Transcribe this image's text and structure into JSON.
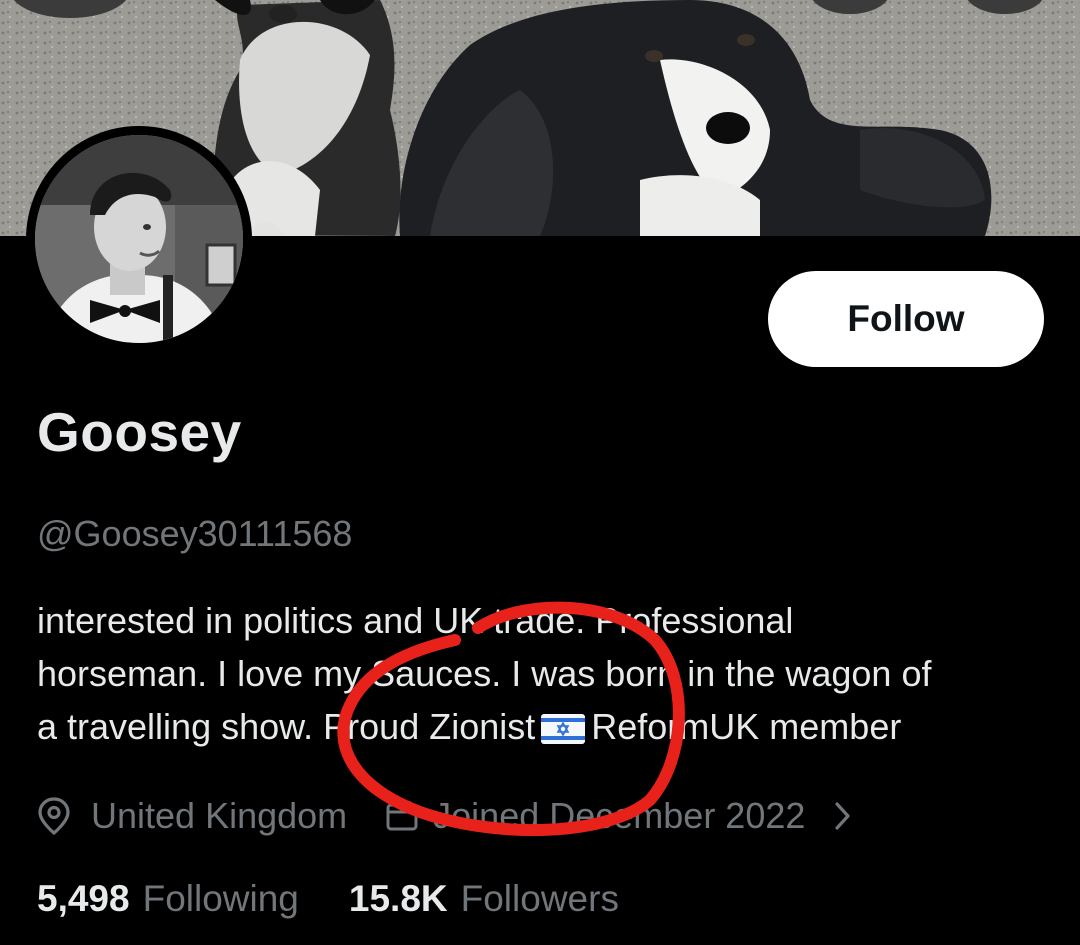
{
  "profile": {
    "display_name": "Goosey",
    "handle": "@Goosey30111568",
    "follow_label": "Follow",
    "bio_lines": [
      "interested in politics and UK trade. Professional",
      "horseman. I love my Sauces. I was born in the wagon of",
      "a travelling show. Proud Zionist",
      "ReformUK member"
    ],
    "location": "United Kingdom",
    "joined": "Joined December 2022",
    "following_count": "5,498",
    "following_label": "Following",
    "followers_count": "15.8K",
    "followers_label": "Followers"
  },
  "icons": {
    "location": "location-pin-icon",
    "calendar": "calendar-icon",
    "chevron": "chevron-right-icon",
    "flag": "israel-flag-emoji"
  },
  "colors": {
    "background": "#000000",
    "text_primary": "#e7e9ea",
    "text_secondary": "#71767b",
    "button_bg": "#ffffff",
    "annotation": "#e8221b"
  }
}
